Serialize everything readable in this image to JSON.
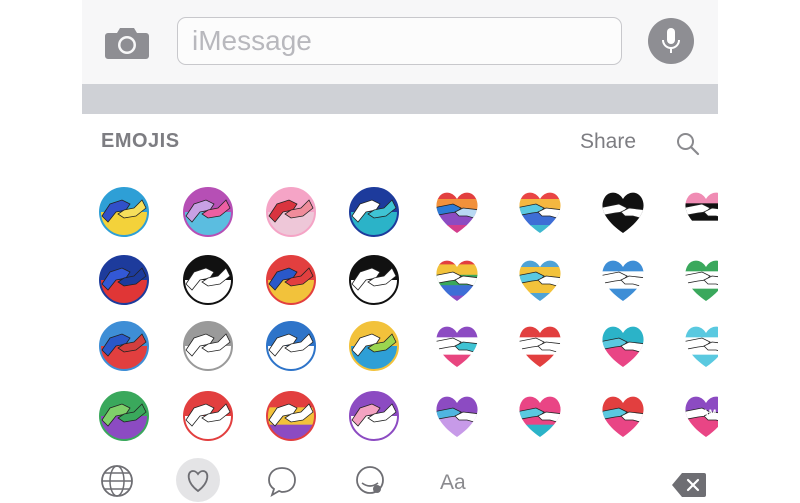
{
  "input_bar": {
    "placeholder": "iMessage",
    "camera_icon": "camera-icon",
    "mic_icon": "microphone-icon"
  },
  "section": {
    "title": "EMOJIS",
    "share_label": "Share",
    "search_icon": "magnifier-icon"
  },
  "stickers": [
    {
      "shape": "circle",
      "colors": [
        "#2e9fd6",
        "#f3d23a"
      ],
      "hands": [
        "#3150c9",
        "#f6df5c"
      ]
    },
    {
      "shape": "circle",
      "colors": [
        "#b64fb5",
        "#5bbde0"
      ],
      "hands": [
        "#c8a1e4",
        "#ec5fa2"
      ]
    },
    {
      "shape": "circle",
      "colors": [
        "#f5a4c6",
        "#eec7d8"
      ],
      "hands": [
        "#d9343f",
        "#f08c9b"
      ]
    },
    {
      "shape": "circle",
      "colors": [
        "#1d3b9c",
        "#2bb3c8"
      ],
      "hands": [
        "#ffffff",
        "#3fc3d3"
      ]
    },
    {
      "shape": "heart",
      "colors": [
        "#e23f3f",
        "#f2913b",
        "#8c4bc2",
        "#d33e8c"
      ],
      "hands": [
        "#2d7bd6",
        "#b9d9f3"
      ]
    },
    {
      "shape": "heart",
      "colors": [
        "#e94545",
        "#f4b740",
        "#3e6ed6",
        "#3fb8cf"
      ],
      "hands": [
        "#5ac9e0",
        "#ffffff"
      ]
    },
    {
      "shape": "heart",
      "colors": [
        "#111111",
        "#111111"
      ],
      "hands": [
        "#ffffff",
        "#ffffff"
      ]
    },
    {
      "shape": "heart",
      "colors": [
        "#f08cb4",
        "#111111",
        "#ffffff"
      ],
      "hands": [
        "#ffffff",
        "#ffffff"
      ]
    },
    {
      "shape": "circle",
      "colors": [
        "#1d3b9c",
        "#e03636"
      ],
      "hands": [
        "#3358d6",
        "#1d3b9c"
      ]
    },
    {
      "shape": "circle",
      "colors": [
        "#111111",
        "#ffffff"
      ],
      "hands": [
        "#ffffff",
        "#ffffff"
      ]
    },
    {
      "shape": "circle",
      "colors": [
        "#e23f3f",
        "#f2c23b"
      ],
      "hands": [
        "#2a58c9",
        "#e23f3f"
      ]
    },
    {
      "shape": "circle",
      "colors": [
        "#111111",
        "#ffffff"
      ],
      "hands": [
        "#ffffff",
        "#ffffff"
      ]
    },
    {
      "shape": "heart",
      "colors": [
        "#e23f3f",
        "#f2c23b",
        "#3aa85c",
        "#3e6ed6",
        "#8c4bc2"
      ],
      "hands": [
        "#ffffff",
        "#ffffff"
      ]
    },
    {
      "shape": "heart",
      "colors": [
        "#4fa3d6",
        "#f2c23b",
        "#f2c23b",
        "#4fa3d6"
      ],
      "hands": [
        "#5ac9e0",
        "#ffffff"
      ]
    },
    {
      "shape": "heart",
      "colors": [
        "#3e8ed6",
        "#ffffff",
        "#3e8ed6"
      ],
      "hands": [
        "#ffffff",
        "#ffffff"
      ]
    },
    {
      "shape": "heart",
      "colors": [
        "#3aa85c",
        "#ffffff",
        "#3aa85c"
      ],
      "hands": [
        "#ffffff",
        "#ffffff"
      ]
    },
    {
      "shape": "circle",
      "colors": [
        "#3e8ed6",
        "#e23f3f"
      ],
      "hands": [
        "#2a58c9",
        "#d33e3e"
      ]
    },
    {
      "shape": "circle",
      "colors": [
        "#9a9a9a",
        "#ffffff"
      ],
      "hands": [
        "#ffffff",
        "#ffffff"
      ]
    },
    {
      "shape": "circle",
      "colors": [
        "#2e74c9",
        "#ffffff"
      ],
      "hands": [
        "#ffffff",
        "#ffffff"
      ]
    },
    {
      "shape": "circle",
      "colors": [
        "#f2c23b",
        "#2e9fd6"
      ],
      "hands": [
        "#ffffff",
        "#9bd64f"
      ]
    },
    {
      "shape": "heart",
      "colors": [
        "#8c4bc2",
        "#ffffff",
        "#e8457f"
      ],
      "hands": [
        "#ffffff",
        "#3fc3d3"
      ]
    },
    {
      "shape": "heart",
      "colors": [
        "#e23f3f",
        "#ffffff",
        "#e23f3f"
      ],
      "hands": [
        "#ffffff",
        "#ffffff"
      ]
    },
    {
      "shape": "heart",
      "colors": [
        "#2bb3c8",
        "#e94585"
      ],
      "hands": [
        "#5ac9e0",
        "#ffffff"
      ]
    },
    {
      "shape": "heart",
      "colors": [
        "#5ac9e0",
        "#ffffff",
        "#5ac9e0"
      ],
      "hands": [
        "#ffffff",
        "#ffffff"
      ]
    },
    {
      "shape": "circle",
      "colors": [
        "#3aa85c",
        "#8c4bc2"
      ],
      "hands": [
        "#7fd06a",
        "#3aa85c"
      ]
    },
    {
      "shape": "circle",
      "colors": [
        "#e23f3f",
        "#ffffff"
      ],
      "hands": [
        "#ffffff",
        "#ffffff"
      ]
    },
    {
      "shape": "circle",
      "colors": [
        "#e23f3f",
        "#f2c23b",
        "#8c4bc2"
      ],
      "hands": [
        "#ffffff",
        "#ffffff"
      ]
    },
    {
      "shape": "circle",
      "colors": [
        "#8c4bc2",
        "#ffffff"
      ],
      "hands": [
        "#f4a3c2",
        "#ffffff"
      ]
    },
    {
      "shape": "heart",
      "colors": [
        "#8c4bc2",
        "#c79ae8"
      ],
      "hands": [
        "#4fb5e0",
        "#ffffff"
      ]
    },
    {
      "shape": "heart",
      "colors": [
        "#e94585",
        "#e94585",
        "#2bb3c8"
      ],
      "hands": [
        "#5ac9e0",
        "#ffffff"
      ]
    },
    {
      "shape": "heart",
      "colors": [
        "#e23f3f",
        "#e94585"
      ],
      "hands": [
        "#5ac9e0",
        "#ffffff"
      ]
    },
    {
      "shape": "heart",
      "colors": [
        "#8c4bc2",
        "#e94585"
      ],
      "hands": [
        "#ffffff",
        "#ffffff"
      ],
      "label": "BAM"
    }
  ],
  "bottom_bar": {
    "globe_icon": "globe-icon",
    "heart_icon": "heart-icon",
    "chat_icon": "speech-bubble-icon",
    "sticker_icon": "sticker-face-icon",
    "text_label": "Aa",
    "delete_icon": "delete-key-icon"
  },
  "colors": {
    "input_bar_bg": "#f7f7f8",
    "gray_band": "#cfd1d6",
    "label_gray": "#7d7d82"
  }
}
